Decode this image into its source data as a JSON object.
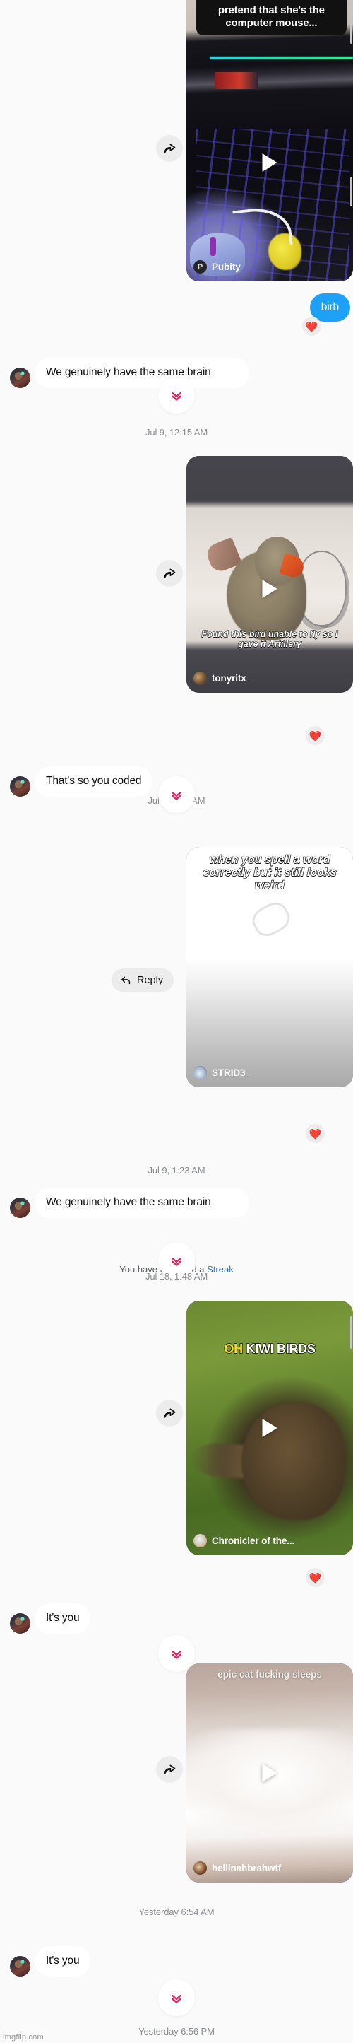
{
  "app": {
    "name": "instagram-direct-message-thread",
    "background": "#fafafa",
    "accent": "#1da1f7",
    "reaction": "❤️"
  },
  "watermark": "imgflip.com",
  "messages": {
    "video1": {
      "caption_line1": "pretend that she's the",
      "caption_line2": "computer mouse...",
      "author": "Pubity",
      "author_badge": "P",
      "play_label": "play"
    },
    "blue1": {
      "text": "birb"
    },
    "text1": {
      "text": "We genuinely have the same brain"
    },
    "stamp1": {
      "text": "Jul 9, 12:15 AM"
    },
    "video2": {
      "caption_line1": "Found this bird unable to fly so I",
      "caption_line2": "gave it Artillery",
      "author": "tonyritx"
    },
    "text2": {
      "text": "That's so you coded"
    },
    "stamp2": {
      "text": "Jul 9, 1:23 AM"
    },
    "video3": {
      "caption_line1": "when you spell a word",
      "caption_line2": "correctly but it still looks",
      "caption_line3": "weird",
      "author": "STRID3_",
      "reply_label": "Reply"
    },
    "stamp3": {
      "text": "Jul 9, 1:23 AM"
    },
    "text3": {
      "text": "We genuinely have the same brain"
    },
    "system1": {
      "prefix": "You have unlocked a ",
      "link": "Streak"
    },
    "stamp4": {
      "text": "Jul 18, 1:48 AM"
    },
    "video4": {
      "caption_highlight": "OH",
      "caption_rest": " KIWI BIRDS",
      "author": "Chronicler of the..."
    },
    "text4": {
      "text": "It's you"
    },
    "video5": {
      "caption": "epic cat fucking sleeps",
      "author": "helllnahbrahwtf"
    },
    "stamp5": {
      "text": "Yesterday 6:54 AM"
    },
    "text5": {
      "text": "It's you"
    },
    "stamp6": {
      "text": "Yesterday 6:56 PM"
    }
  },
  "icons": {
    "share": "share-arrow-icon",
    "play": "play-icon",
    "reply": "reply-arrow-icon",
    "chevrons": "double-chevron-down-icon"
  }
}
